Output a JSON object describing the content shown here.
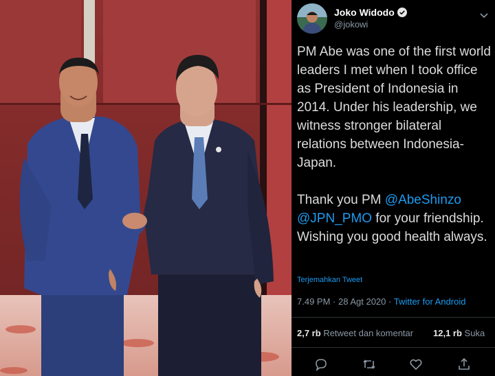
{
  "tweet": {
    "display_name": "Joko Widodo",
    "handle": "@jokowi",
    "paragraph1": "PM Abe was one of the first world leaders I met when I took office as President of Indonesia in 2014. Under his leadership, we witness stronger bilateral relations between Indonesia-Japan.",
    "p2_prefix": "Thank you PM ",
    "mention1": "@AbeShinzo",
    "mention2": "@JPN_PMO",
    "p2_suffix": " for your friendship. Wishing you good health always.",
    "translate_label": "Terjemahkan Tweet",
    "time": "7.49 PM",
    "date": "28 Agt 2020",
    "separator": " · ",
    "client": "Twitter for Android",
    "retweets_count": "2,7 rb",
    "retweets_label": "Retweet dan komentar",
    "likes_count": "12,1 rb",
    "likes_label": "Suka"
  },
  "icons": {
    "verified": "verified-badge-icon",
    "more": "chevron-down-icon",
    "reply": "reply-icon",
    "retweet": "retweet-icon",
    "like": "heart-icon",
    "share": "share-icon"
  },
  "colors": {
    "link": "#1d9bf0",
    "background": "#000000",
    "muted": "#8b98a5"
  }
}
